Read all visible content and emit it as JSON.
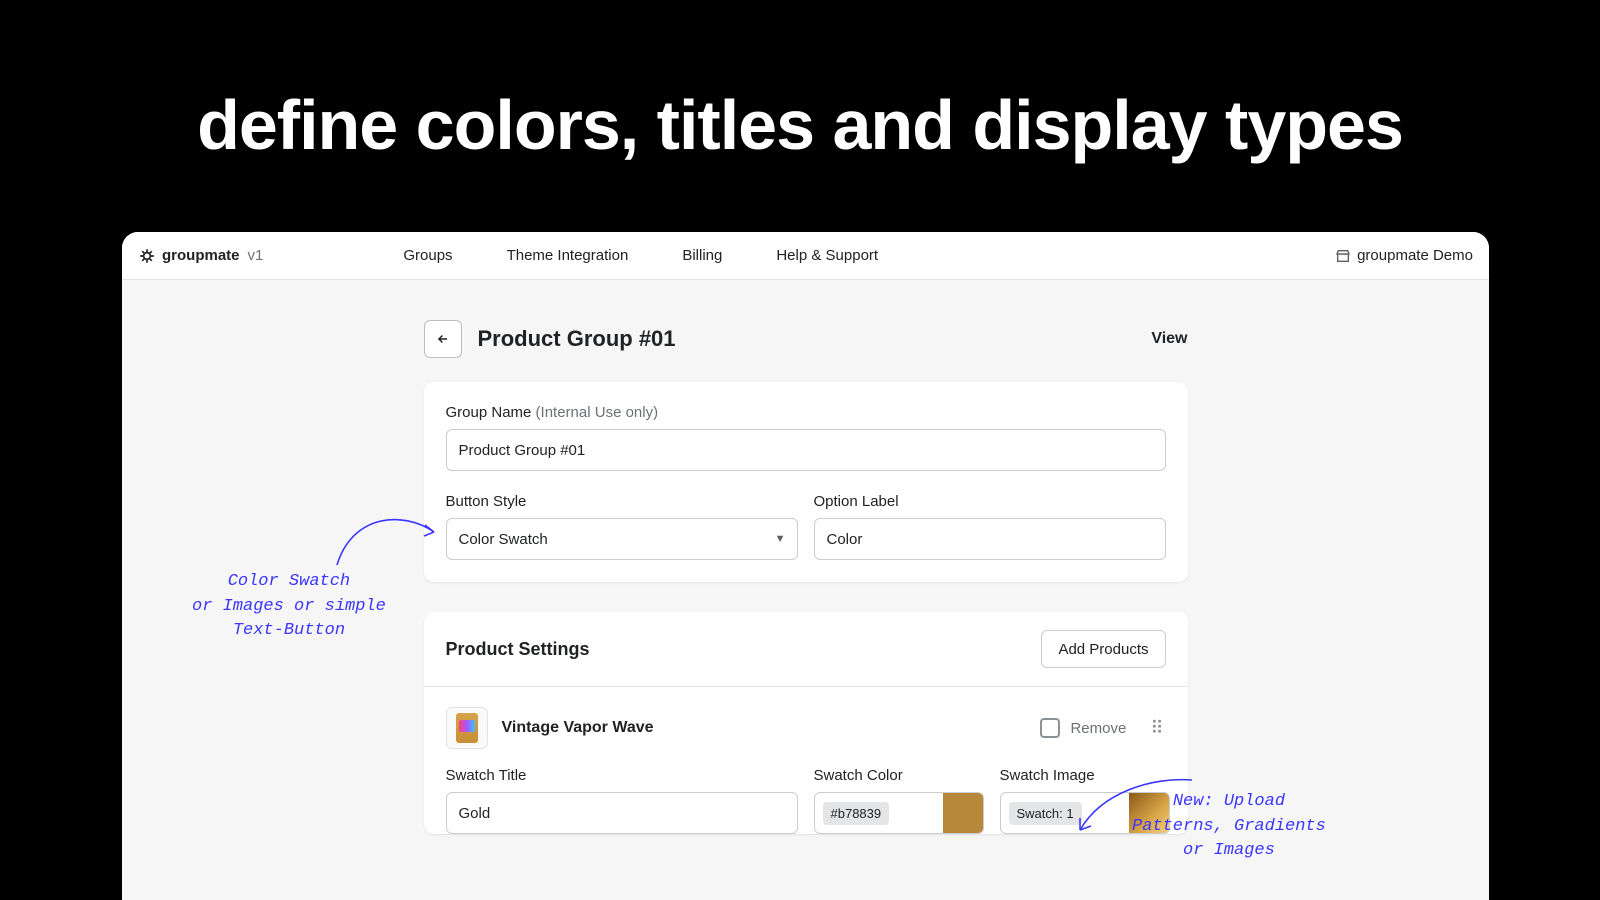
{
  "hero": {
    "title": "define colors, titles and display types"
  },
  "brand": {
    "name": "groupmate",
    "version": "v1"
  },
  "nav": {
    "items": [
      "Groups",
      "Theme Integration",
      "Billing",
      "Help & Support"
    ]
  },
  "store": {
    "label": "groupmate Demo"
  },
  "page": {
    "title": "Product Group #01",
    "view_label": "View"
  },
  "form": {
    "group_name_label": "Group Name",
    "group_name_hint": "(Internal Use only)",
    "group_name_value": "Product Group #01",
    "button_style_label": "Button Style",
    "button_style_value": "Color Swatch",
    "option_label_label": "Option Label",
    "option_label_value": "Color"
  },
  "settings": {
    "title": "Product Settings",
    "add_button": "Add Products"
  },
  "product": {
    "name": "Vintage Vapor Wave",
    "remove_label": "Remove",
    "swatch_title_label": "Swatch Title",
    "swatch_title_value": "Gold",
    "swatch_color_label": "Swatch Color",
    "swatch_color_value": "#b78839",
    "swatch_image_label": "Swatch Image",
    "swatch_image_value": "Swatch: 1"
  },
  "annotations": {
    "left_l1": "Color Swatch",
    "left_l2": "or Images or simple",
    "left_l3": "Text-Button",
    "right_l1": "New: Upload",
    "right_l2": "Patterns, Gradients",
    "right_l3": "or Images"
  }
}
